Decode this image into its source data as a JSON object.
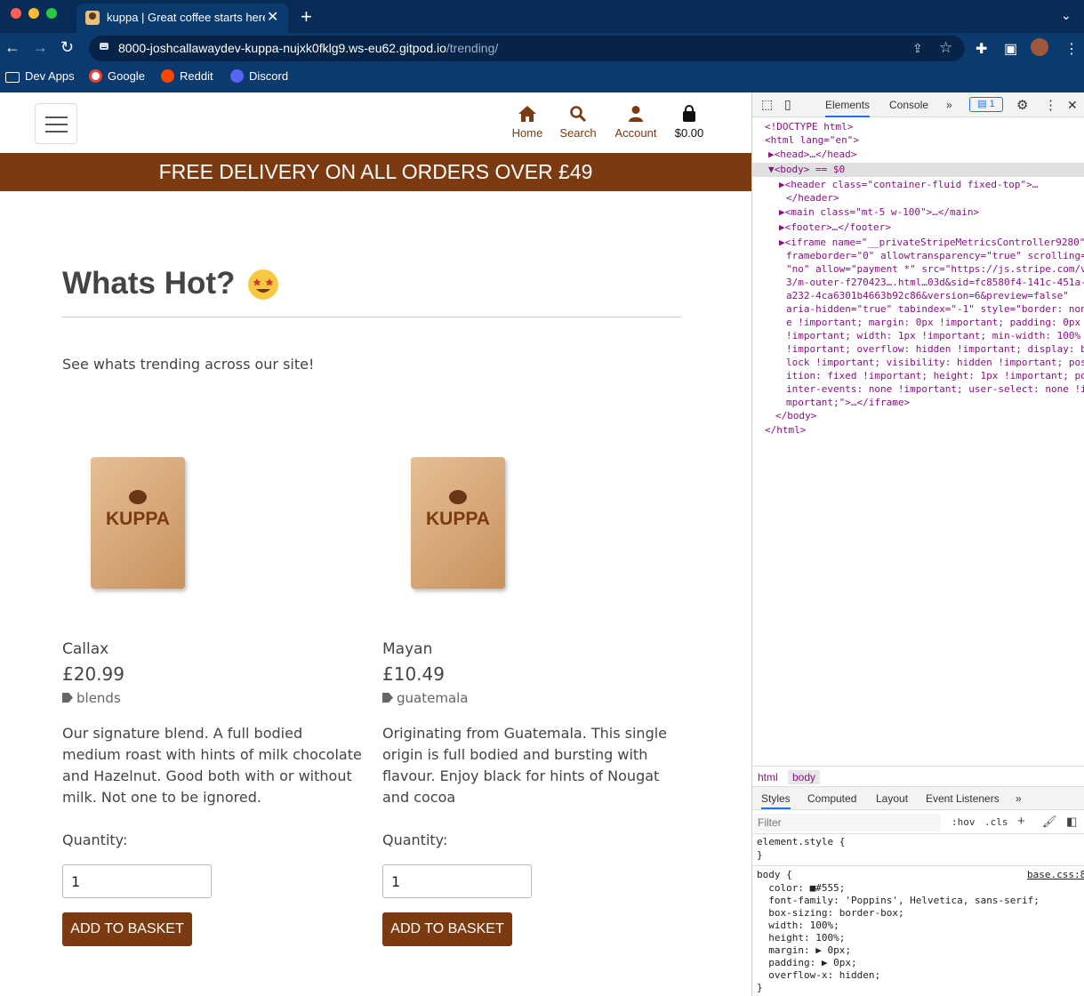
{
  "browser": {
    "tab_title": "kuppa | Great coffee starts here",
    "tab_close": "✕",
    "new_tab": "+",
    "url_host": "8000-joshcallawaydev-kuppa-nujxk0fklg9.ws-eu62.gitpod.io",
    "url_path": "/trending/",
    "bookmarks": [
      "Dev Apps",
      "Google",
      "Reddit",
      "Discord"
    ]
  },
  "header": {
    "nav": [
      {
        "label": "Home",
        "icon": "home-icon"
      },
      {
        "label": "Search",
        "icon": "search-icon"
      },
      {
        "label": "Account",
        "icon": "user-icon"
      },
      {
        "label": "$0.00",
        "icon": "shopping-bag-icon"
      }
    ]
  },
  "banner": "FREE DELIVERY ON ALL ORDERS OVER £49",
  "main": {
    "title": "Whats Hot?",
    "subtitle": "See whats trending across our site!",
    "products": [
      {
        "brand": "KUPPA",
        "name": "Callax",
        "price": "£20.99",
        "tag": "blends",
        "description": "Our signature blend. A full bodied medium roast with hints of milk chocolate and Hazelnut. Good both with or without milk. Not one to be ignored.",
        "quantity_label": "Quantity:",
        "quantity": "1",
        "button": "ADD TO BASKET"
      },
      {
        "brand": "KUPPA",
        "name": "Mayan",
        "price": "£10.49",
        "tag": "guatemala",
        "description": "Originating from Guatemala. This single origin is full bodied and bursting with flavour. Enjoy black for hints of Nougat and cocoa",
        "quantity_label": "Quantity:",
        "quantity": "1",
        "button": "ADD TO BASKET"
      }
    ]
  },
  "devtools": {
    "tabs": [
      "Elements",
      "Console",
      "»"
    ],
    "badge": "1",
    "crumbs": [
      "html",
      "body"
    ],
    "style_tabs": [
      "Styles",
      "Computed",
      "Layout",
      "Event Listeners",
      "»"
    ],
    "filter_placeholder": "Filter",
    "hov": ":hov",
    "cls": ".cls",
    "dom_lines": [
      "<!DOCTYPE html>",
      "<html lang=\"en\">",
      "▶<head>…</head>",
      "▼<body> == $0",
      "▶<header class=\"container-fluid fixed-top\">…",
      "</header>",
      "▶<main class=\"mt-5 w-100\">…</main>",
      "▶<footer>…</footer>",
      "▶<iframe name=\"__privateStripeMetricsController9280\"",
      "frameborder=\"0\" allowtransparency=\"true\" scrolling=",
      "\"no\" allow=\"payment *\" src=\"https://js.stripe.com/v",
      "3/m-outer-f270423….html…03d&sid=fc8580f4-141c-451a-",
      "a232-4ca6301b4663b92c86&version=6&preview=false\"",
      "aria-hidden=\"true\" tabindex=\"-1\" style=\"border: non",
      "e !important; margin: 0px !important; padding: 0px",
      "!important; width: 1px !important; min-width: 100%",
      "!important; overflow: hidden !important; display: b",
      "lock !important; visibility: hidden !important; pos",
      "ition: fixed !important; height: 1px !important; po",
      "inter-events: none !important; user-select: none !i",
      "mportant;\">…</iframe>",
      "</body>",
      "</html>"
    ],
    "css_lines": [
      "element.style {",
      "}",
      "body {",
      "  color: ■#555;",
      "  font-family: 'Poppins', Helvetica, sans-serif;",
      "  box-sizing: border-box;",
      "  width: 100%;",
      "  height: 100%;",
      "  margin: ▶ 0px;",
      "  padding: ▶ 0px;",
      "  overflow-x: hidden;",
      "}"
    ],
    "css_source": "base.css:8"
  },
  "colors": {
    "brand": "#7b3a10",
    "chrome": "#0b3a6e"
  }
}
